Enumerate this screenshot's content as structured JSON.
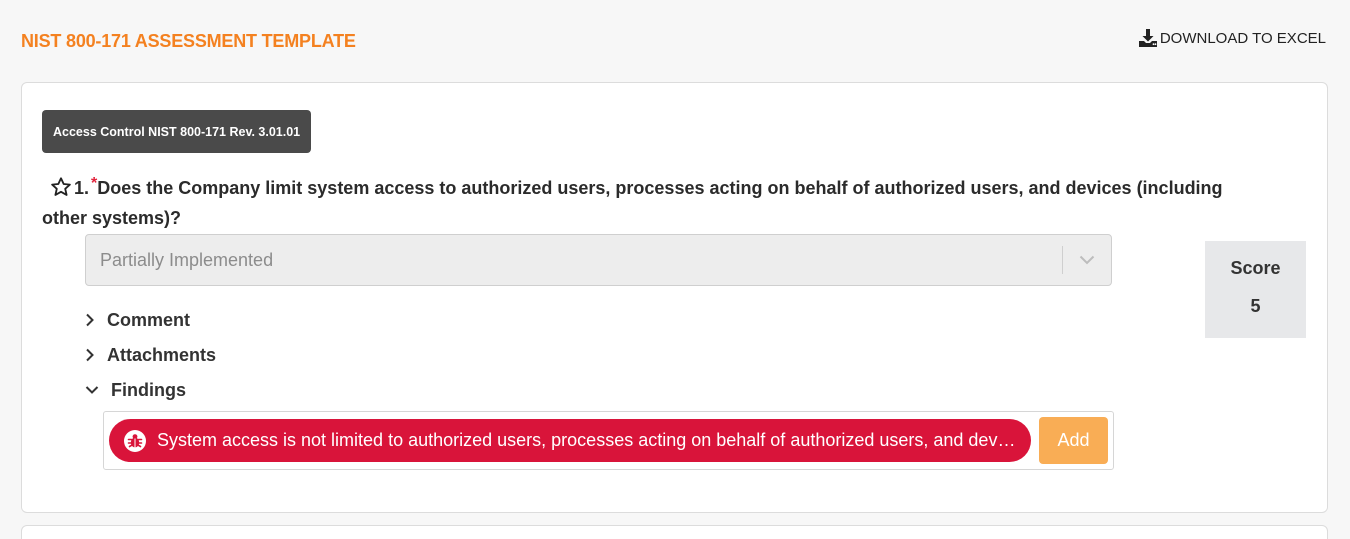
{
  "header": {
    "title": "NIST 800-171 ASSESSMENT TEMPLATE",
    "download_label": "DOWNLOAD TO EXCEL",
    "title_color": "#f48120"
  },
  "question": {
    "category": "Access Control NIST 800-171 Rev. 3.01.01",
    "number": "1.",
    "required_mark": "*",
    "text": "Does the Company limit system access to authorized users, processes acting on behalf of authorized users, and devices (including other systems)?",
    "answer": "Partially Implemented",
    "score_label": "Score",
    "score_value": "5",
    "sections": {
      "comment": "Comment",
      "attachments": "Attachments",
      "findings": "Findings"
    },
    "finding": {
      "text": "System access is not limited to authorized users, processes acting on behalf of authorized users, and dev…",
      "add_label": "Add",
      "color": "#d9143a"
    }
  },
  "icons": {
    "download": "download-icon",
    "star": "star-outline-icon",
    "chevron": "chevron-down-icon",
    "bug": "bug-icon"
  }
}
